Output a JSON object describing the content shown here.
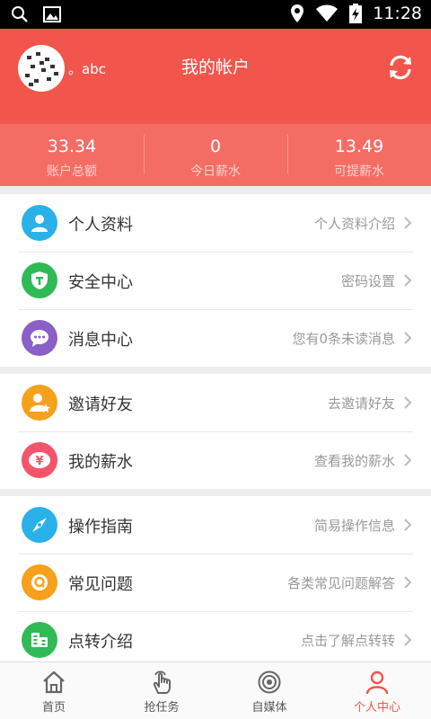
{
  "status_bar": {
    "time": "11:28"
  },
  "header": {
    "username": "。abc",
    "title": "我的帐户"
  },
  "stats": [
    {
      "value": "33.34",
      "label": "账户总额"
    },
    {
      "value": "0",
      "label": "今日薪水"
    },
    {
      "value": "13.49",
      "label": "可提薪水"
    }
  ],
  "groups": [
    {
      "items": [
        {
          "label": "个人资料",
          "hint": "个人资料介绍",
          "icon": "person-icon",
          "color": "#2ab1e9"
        },
        {
          "label": "安全中心",
          "hint": "密码设置",
          "icon": "shield-icon",
          "color": "#2fba55"
        },
        {
          "label": "消息中心",
          "hint": "您有0条未读消息",
          "icon": "message-icon",
          "color": "#8a5fc7"
        }
      ]
    },
    {
      "items": [
        {
          "label": "邀请好友",
          "hint": "去邀请好友",
          "icon": "invite-friend-icon",
          "color": "#f5a11c"
        },
        {
          "label": "我的薪水",
          "hint": "查看我的薪水",
          "icon": "yen-icon",
          "color": "#f2556a"
        }
      ]
    },
    {
      "items": [
        {
          "label": "操作指南",
          "hint": "简易操作信息",
          "icon": "compass-icon",
          "color": "#2ab1e9"
        },
        {
          "label": "常见问题",
          "hint": "各类常见问题解答",
          "icon": "question-icon",
          "color": "#f5a11c"
        },
        {
          "label": "点转介绍",
          "hint": "点击了解点转转",
          "icon": "info-card-icon",
          "color": "#2fba55"
        }
      ]
    }
  ],
  "bottom_nav": [
    {
      "label": "首页",
      "icon": "home-icon"
    },
    {
      "label": "抢任务",
      "icon": "tap-hand-icon"
    },
    {
      "label": "自媒体",
      "icon": "target-icon"
    },
    {
      "label": "个人中心",
      "icon": "user-icon",
      "active": true
    }
  ],
  "colors": {
    "header": "#f2554b",
    "stats_bar": "#f46d65",
    "active_tab": "#f2554b"
  }
}
